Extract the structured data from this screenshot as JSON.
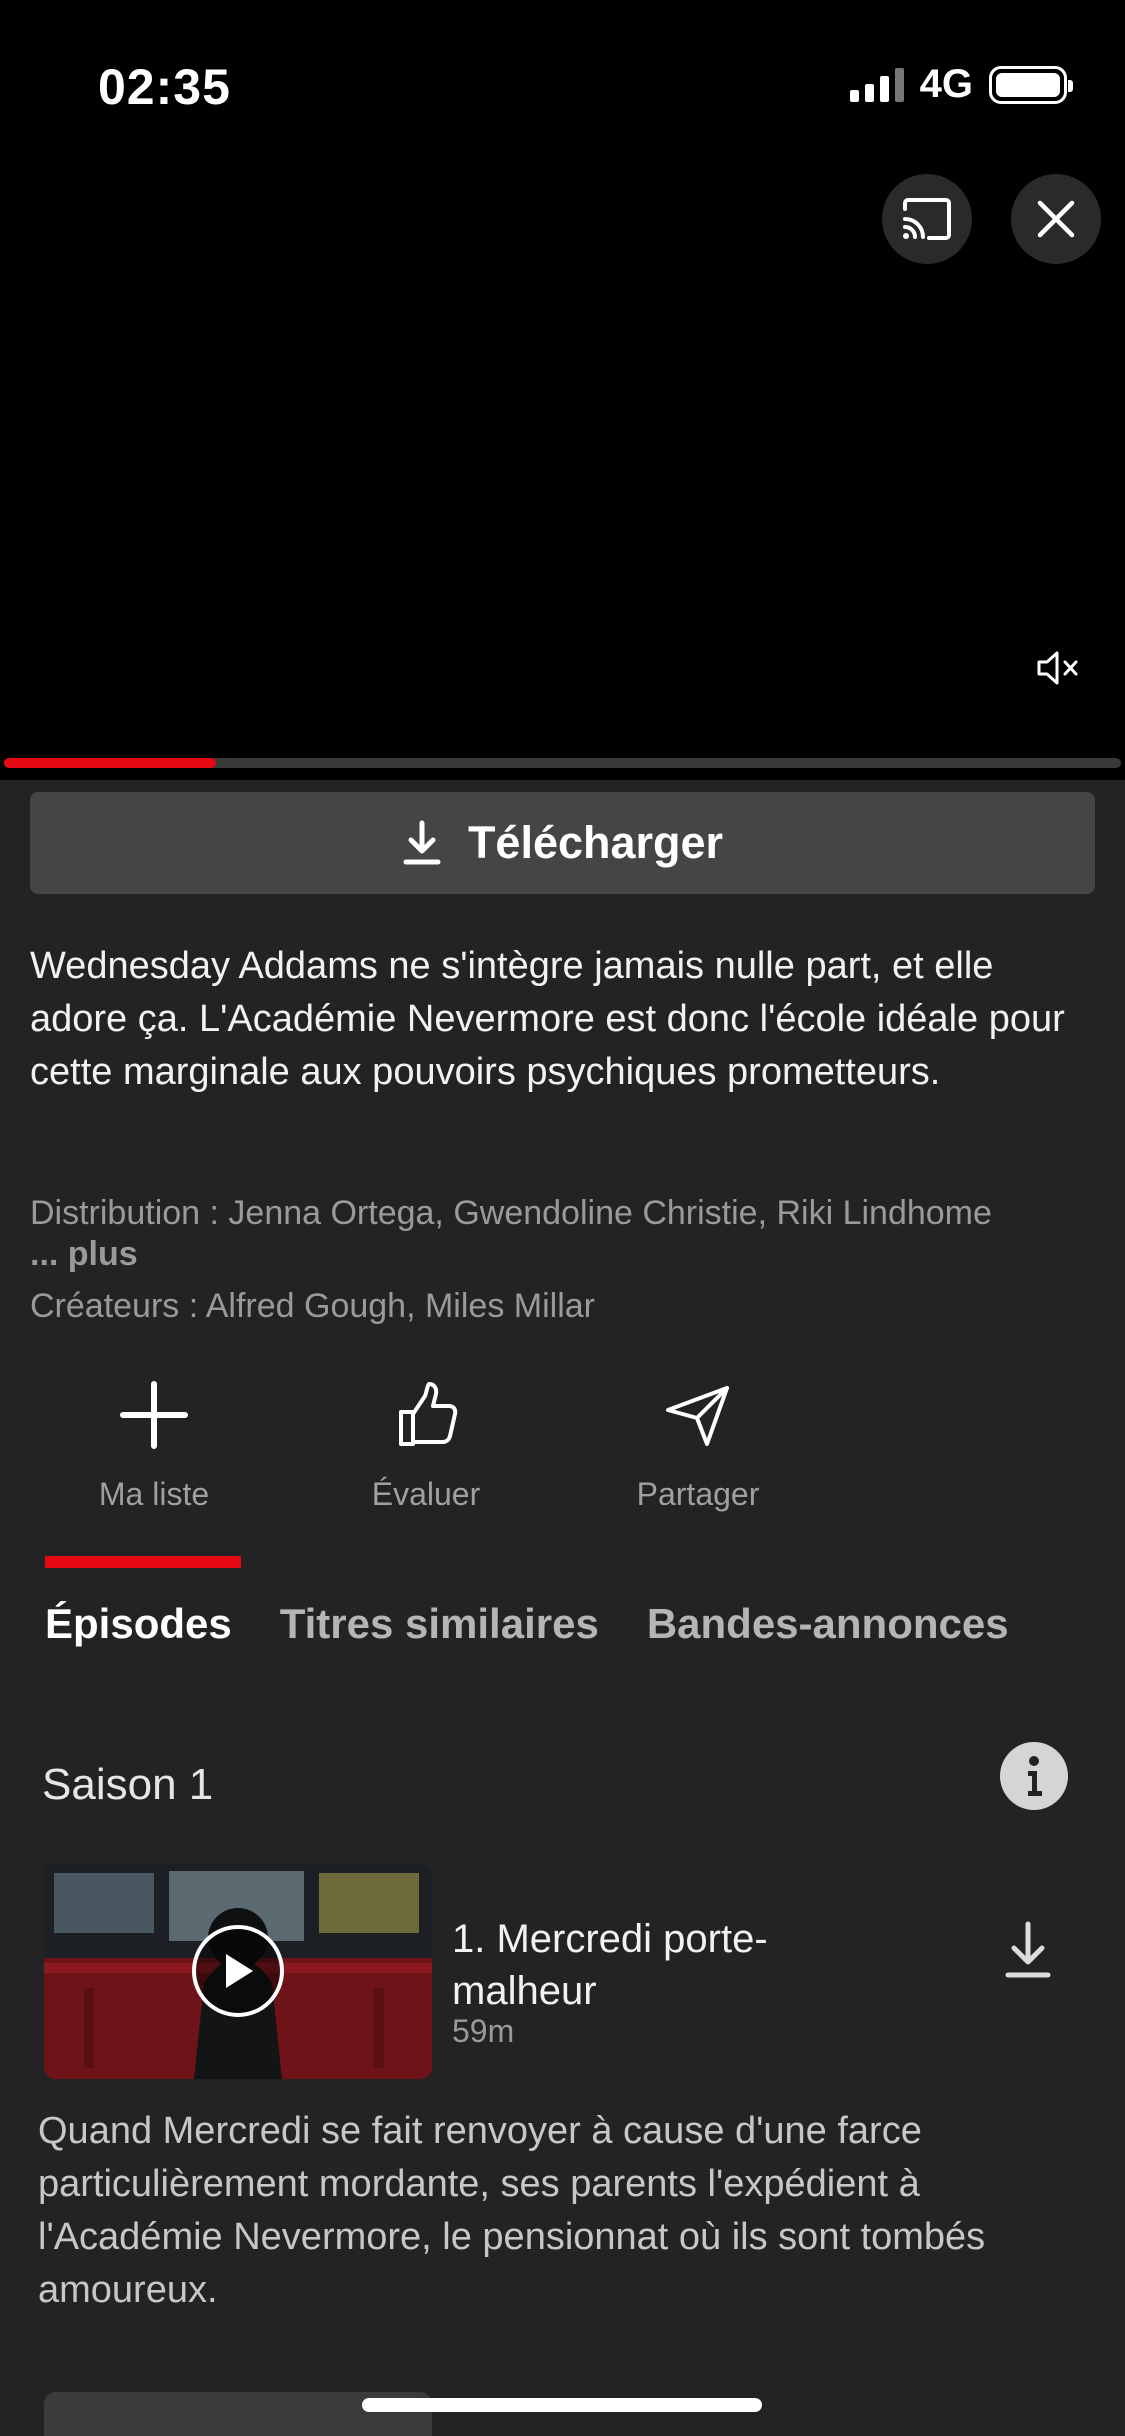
{
  "status": {
    "time": "02:35",
    "network": "4G"
  },
  "video": {
    "progress": 0.19
  },
  "download_label": "Télécharger",
  "synopsis": "Wednesday Addams ne s'intègre jamais nulle part, et elle adore ça. L'Académie Nevermore est donc l'école idéale pour cette marginale aux pouvoirs psychiques prometteurs.",
  "cast_line": "Distribution : Jenna Ortega, Gwendoline Christie, Riki Lindhome",
  "more_label": "... plus",
  "creators_line": "Créateurs : Alfred Gough, Miles Millar",
  "actions": [
    {
      "label": "Ma liste",
      "icon": "plus-icon"
    },
    {
      "label": "Évaluer",
      "icon": "thumbs-up-icon"
    },
    {
      "label": "Partager",
      "icon": "share-icon"
    }
  ],
  "tabs": [
    {
      "label": "Épisodes",
      "active": true
    },
    {
      "label": "Titres similaires",
      "active": false
    },
    {
      "label": "Bandes-annonces",
      "active": false
    }
  ],
  "season_label": "Saison 1",
  "episodes": [
    {
      "title": "1. Mercredi porte-malheur",
      "duration": "59m",
      "description": "Quand Mercredi se fait renvoyer à cause d'une farce particulièrement mordante, ses parents l'expédient à l'Académie Nevermore, le pensionnat où ils sont tombés amoureux."
    }
  ],
  "colors": {
    "accent": "#e50914",
    "background": "#232323"
  }
}
